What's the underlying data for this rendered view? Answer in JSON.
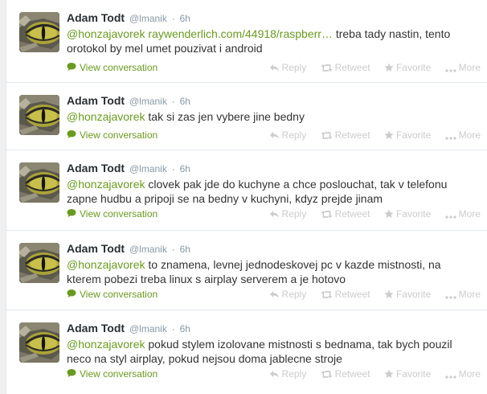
{
  "tweets": [
    {
      "fullname": "Adam Todt",
      "username": "@lmanik",
      "separator": "·",
      "time": "6h",
      "mention": "@honzajavorek",
      "link": "raywenderlich.com/44918/raspberr…",
      "text": " treba tady nastin, tento orotokol by mel umet pouzivat i android",
      "view_conversation": "View conversation",
      "reply": "Reply",
      "retweet": "Retweet",
      "favorite": "Favorite",
      "more": "More"
    },
    {
      "fullname": "Adam Todt",
      "username": "@lmanik",
      "separator": "·",
      "time": "6h",
      "mention": "@honzajavorek",
      "link": "",
      "text": " tak si zas jen vybere jine bedny",
      "view_conversation": "View conversation",
      "reply": "Reply",
      "retweet": "Retweet",
      "favorite": "Favorite",
      "more": "More"
    },
    {
      "fullname": "Adam Todt",
      "username": "@lmanik",
      "separator": "·",
      "time": "6h",
      "mention": "@honzajavorek",
      "link": "",
      "text": " clovek pak jde do kuchyne a chce poslouchat, tak v telefonu zapne hudbu a pripoji se na bedny v kuchyni, kdyz prejde jinam",
      "view_conversation": "View conversation",
      "reply": "Reply",
      "retweet": "Retweet",
      "favorite": "Favorite",
      "more": "More"
    },
    {
      "fullname": "Adam Todt",
      "username": "@lmanik",
      "separator": "·",
      "time": "6h",
      "mention": "@honzajavorek",
      "link": "",
      "text": " to znamena, levnej jednodeskovej pc v kazde mistnosti, na kterem pobezi treba linux s airplay serverem a je hotovo",
      "view_conversation": "View conversation",
      "reply": "Reply",
      "retweet": "Retweet",
      "favorite": "Favorite",
      "more": "More"
    },
    {
      "fullname": "Adam Todt",
      "username": "@lmanik",
      "separator": "·",
      "time": "6h",
      "mention": "@honzajavorek",
      "link": "",
      "text": " pokud stylem izolovane mistnosti s bednama, tak bych pouzil neco na styl airplay, pokud nejsou doma jablecne stroje",
      "view_conversation": "View conversation",
      "reply": "Reply",
      "retweet": "Retweet",
      "favorite": "Favorite",
      "more": "More"
    }
  ],
  "colors": {
    "accent": "#6a9a1f",
    "muted": "#8899a6",
    "action": "#cccccc",
    "name": "#292f33",
    "border": "#e1e8ed"
  },
  "icons": {
    "avatar": "cat-eye-avatar",
    "view_conversation": "speech-bubble-icon",
    "reply": "reply-arrow-icon",
    "retweet": "retweet-icon",
    "favorite": "star-icon",
    "more": "ellipsis-icon"
  }
}
